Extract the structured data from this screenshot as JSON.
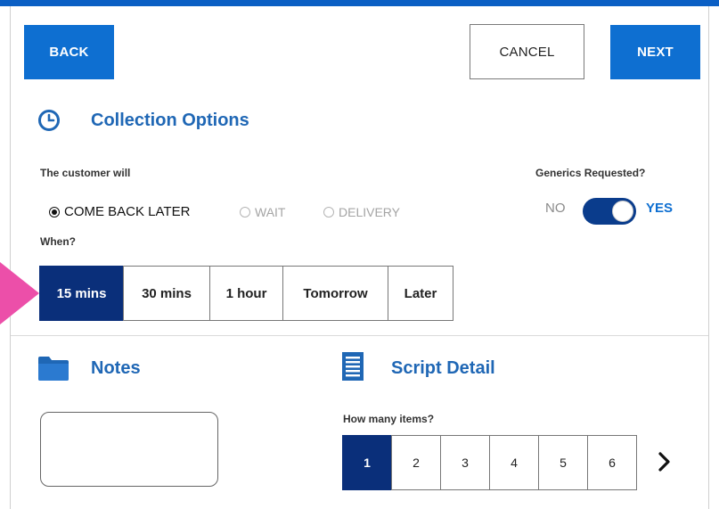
{
  "header": {
    "back_label": "BACK",
    "cancel_label": "CANCEL",
    "next_label": "NEXT"
  },
  "collection": {
    "title": "Collection Options",
    "customer_label": "The customer will",
    "options": [
      {
        "label": "COME BACK LATER",
        "selected": true
      },
      {
        "label": "WAIT",
        "selected": false
      },
      {
        "label": "DELIVERY",
        "selected": false
      }
    ],
    "generics_label": "Generics Requested?",
    "generics_no": "NO",
    "generics_yes": "YES",
    "generics_value": true,
    "when_label": "When?",
    "when_options": [
      "15 mins",
      "30 mins",
      "1 hour",
      "Tomorrow",
      "Later"
    ],
    "when_selected": "15 mins"
  },
  "notes": {
    "title": "Notes",
    "value": ""
  },
  "script": {
    "title": "Script Detail",
    "items_label": "How many items?",
    "items": [
      "1",
      "2",
      "3",
      "4",
      "5",
      "6"
    ],
    "items_selected": "1"
  },
  "icons": {
    "collection": "clock-icon",
    "notes": "folder-icon",
    "script": "document-list-icon",
    "pager_next": "chevron-right-icon",
    "pointer": "pink-arrow-pointer"
  },
  "colors": {
    "primary": "#0e6fd1",
    "active_dark": "#0a2f7a",
    "title_blue": "#1f67b5",
    "pointer_pink": "#ec4fa9"
  }
}
